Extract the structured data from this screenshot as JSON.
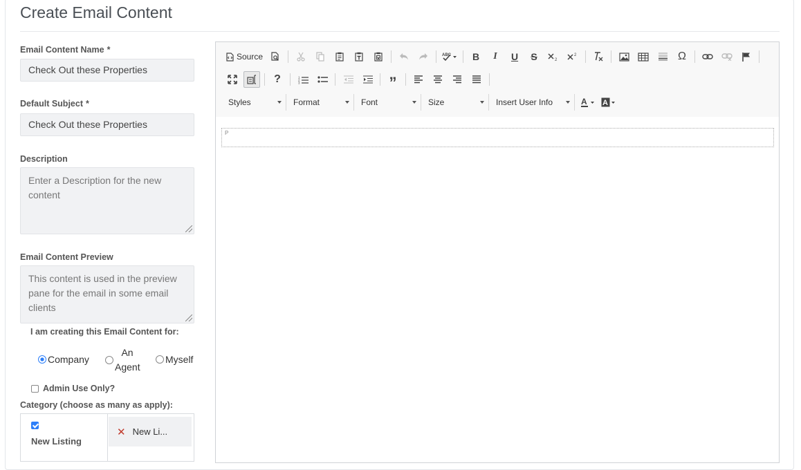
{
  "page": {
    "title": "Create Email Content"
  },
  "form": {
    "name": {
      "label": "Email Content Name",
      "required_mark": "*",
      "value": "Check Out these Properties"
    },
    "subject": {
      "label": "Default Subject",
      "required_mark": "*",
      "value": "Check Out these Properties"
    },
    "description": {
      "label": "Description",
      "placeholder": "Enter a Description for the new content"
    },
    "preview": {
      "label": "Email Content Preview",
      "placeholder": "This content is used in the preview pane for the email in some email clients"
    },
    "creating_for": {
      "question": "I am creating this Email Content for:",
      "options": [
        {
          "label": "Company",
          "checked": true
        },
        {
          "label": "An Agent",
          "checked": false
        },
        {
          "label": "Myself",
          "checked": false
        }
      ]
    },
    "admin_only": {
      "label": "Admin Use Only?",
      "checked": false
    },
    "category": {
      "label": "Category (choose as many as apply):",
      "options": [
        {
          "label": "New Listing",
          "checked": true
        }
      ],
      "selected": [
        {
          "label": "New Li..."
        }
      ]
    }
  },
  "editor": {
    "source_label": "Source",
    "combos": {
      "styles": "Styles",
      "format": "Format",
      "font": "Font",
      "size": "Size",
      "user_info": "Insert User Info"
    },
    "paragraph_tag": "P"
  }
}
